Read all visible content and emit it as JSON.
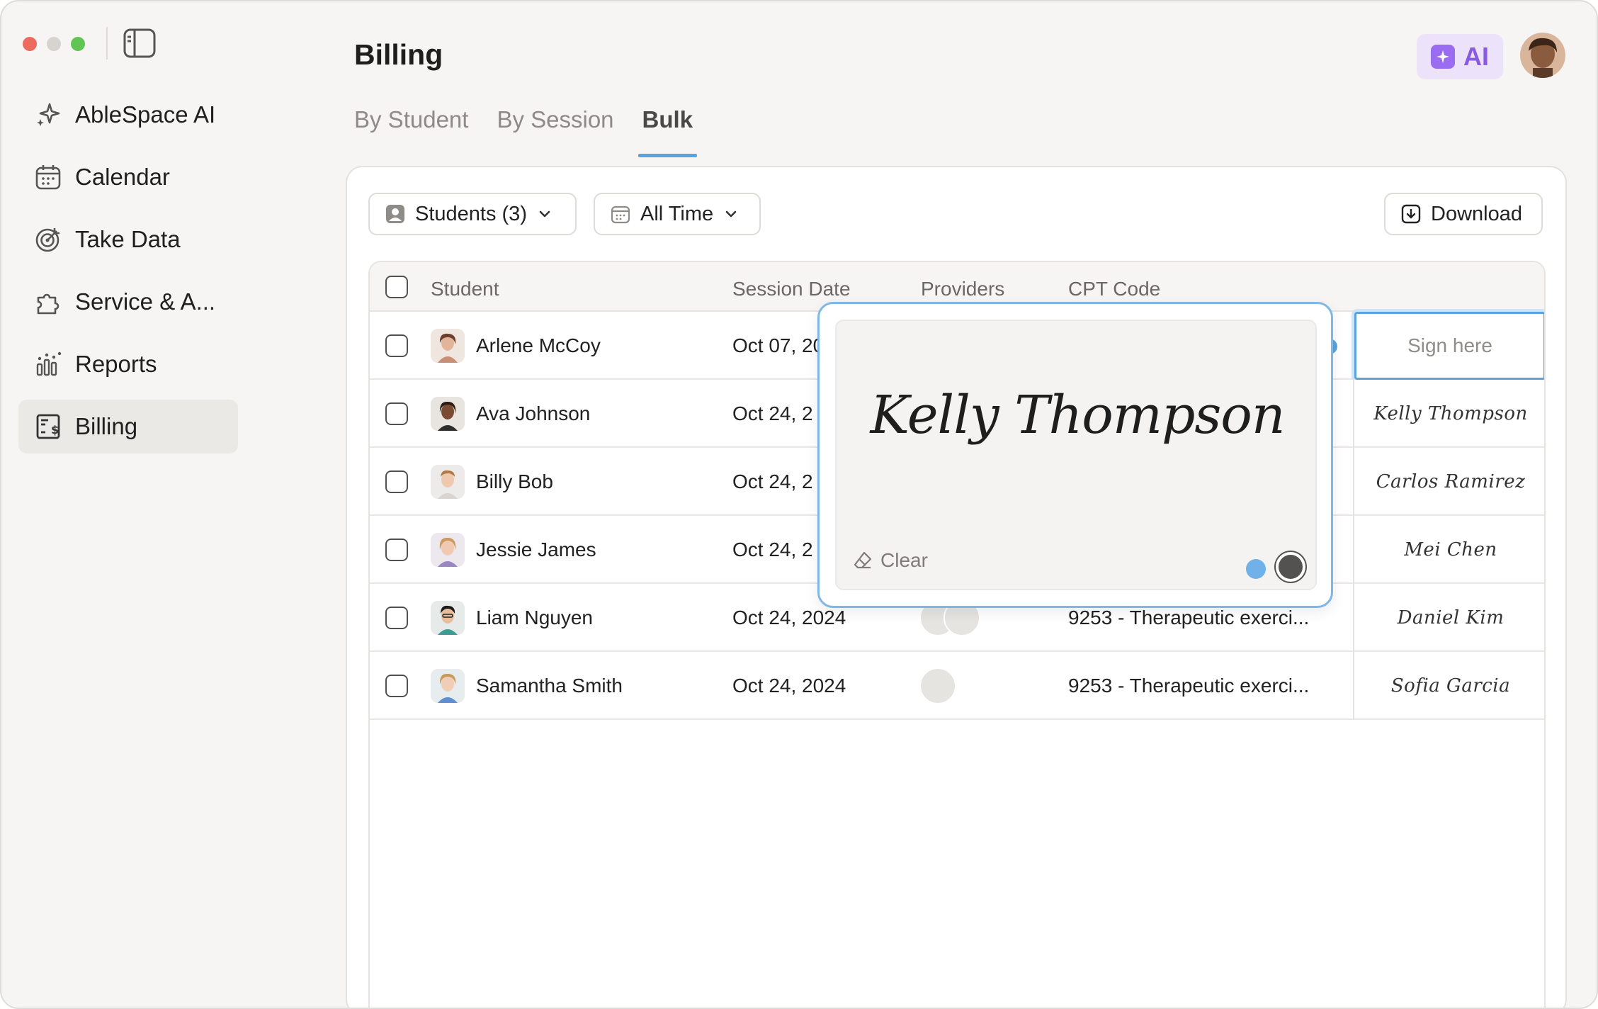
{
  "window": {
    "title": "Billing"
  },
  "sidebar": {
    "items": [
      {
        "label": "AbleSpace AI",
        "icon": "sparkle-icon"
      },
      {
        "label": "Calendar",
        "icon": "calendar-icon"
      },
      {
        "label": "Take Data",
        "icon": "target-icon"
      },
      {
        "label": "Service & A...",
        "icon": "puzzle-icon"
      },
      {
        "label": "Reports",
        "icon": "bar-chart-icon"
      },
      {
        "label": "Billing",
        "icon": "billing-icon",
        "active": true
      }
    ]
  },
  "header": {
    "ai_label": "AI"
  },
  "tabs": [
    {
      "label": "By Student"
    },
    {
      "label": "By Session"
    },
    {
      "label": "Bulk",
      "active": true
    }
  ],
  "filters": {
    "students": "Students (3)",
    "time": "All Time",
    "download": "Download"
  },
  "table": {
    "columns": [
      "Student",
      "Session Date",
      "Providers",
      "CPT Code"
    ],
    "rows": [
      {
        "student": "Arlene McCoy",
        "date": "Oct 07, 20",
        "providers": 0,
        "cpt": "",
        "signature": "Sign here"
      },
      {
        "student": "Ava Johnson",
        "date": "Oct 24, 2",
        "providers": 0,
        "cpt": "",
        "signature": "Kelly Thompson"
      },
      {
        "student": "Billy Bob",
        "date": "Oct 24, 2",
        "providers": 0,
        "cpt": "",
        "signature": "Carlos Ramirez"
      },
      {
        "student": "Jessie James",
        "date": "Oct 24, 2",
        "providers": 0,
        "cpt": "",
        "signature": "Mei Chen"
      },
      {
        "student": "Liam Nguyen",
        "date": "Oct 24, 2024",
        "providers": 2,
        "cpt": "9253 - Therapeutic exerci...",
        "signature": "Daniel Kim"
      },
      {
        "student": "Samantha Smith",
        "date": "Oct 24, 2024",
        "providers": 1,
        "cpt": "9253 - Therapeutic exerci...",
        "signature": "Sofia Garcia"
      }
    ]
  },
  "signature_pad": {
    "signature": "Kelly Thompson",
    "clear_label": "Clear",
    "colors": [
      "#6fb1e8",
      "#545250"
    ],
    "selected_color": "#545250"
  },
  "colors": {
    "accent": "#5aa3dd",
    "ai_purple": "#9a6cf0"
  }
}
